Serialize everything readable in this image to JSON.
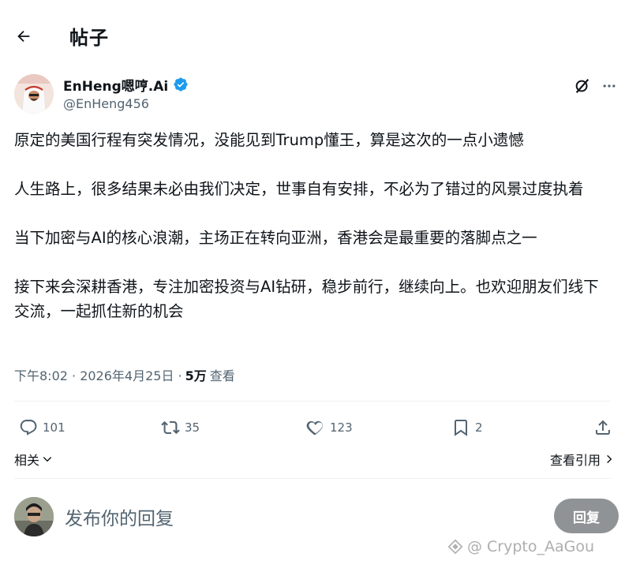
{
  "header": {
    "title": "帖子"
  },
  "author": {
    "display_name": "EnHeng嗯哼.Ai",
    "handle": "@EnHeng456",
    "verified": true
  },
  "post": {
    "paragraphs": [
      "原定的美国行程有突发情况，没能见到Trump懂王，算是这次的一点小遗憾",
      "人生路上，很多结果未必由我们决定，世事自有安排，不必为了错过的风景过度执着",
      "当下加密与AI的核心浪潮，主场正在转向亚洲，香港会是最重要的落脚点之一",
      "接下来会深耕香港，专注加密投资与AI钻研，稳步前行，继续向上。也欢迎朋友们线下交流，一起抓住新的机会"
    ],
    "time": "下午8:02 · 2026年4月25日 · ",
    "views_count": "5万",
    "views_label": "查看"
  },
  "actions": {
    "replies": "101",
    "reposts": "35",
    "likes": "123",
    "bookmarks": "2"
  },
  "links": {
    "related": "相关",
    "view_quotes": "查看引用"
  },
  "reply": {
    "placeholder": "发布你的回复",
    "button": "回复"
  },
  "watermark": "@ Crypto_AaGou",
  "colors": {
    "text_primary": "#0f1419",
    "text_secondary": "#536471",
    "verified_blue": "#1d9bf0",
    "reply_button_disabled": "#8f9396",
    "divider": "#eff3f4"
  }
}
